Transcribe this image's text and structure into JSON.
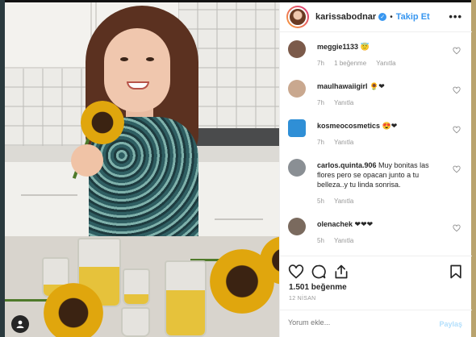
{
  "post": {
    "username": "karissabodnar",
    "follow_label": "Takip Et",
    "more_label": "•••",
    "separator": "•"
  },
  "comments": [
    {
      "username": "meggie1133",
      "text": "😇",
      "time": "7h",
      "likes": "1 beğenme",
      "reply": "Yanıtla",
      "avatar_color": "#7b5a4a"
    },
    {
      "username": "maulhawaiigirl",
      "text": "🌻❤",
      "time": "7h",
      "likes": "",
      "reply": "Yanıtla",
      "avatar_color": "#c9a88f"
    },
    {
      "username": "kosmeocosmetics",
      "text": "😍❤",
      "time": "7h",
      "likes": "",
      "reply": "Yanıtla",
      "avatar_color": "#2f8fd6"
    },
    {
      "username": "carlos.quinta.906",
      "text": "Muy bonitas las flores pero se opacan junto a tu belleza..y tu linda sonrisa.",
      "time": "5h",
      "likes": "",
      "reply": "Yanıtla",
      "avatar_color": "#8a8f94"
    },
    {
      "username": "olenachek",
      "text": "❤❤❤",
      "time": "5h",
      "likes": "",
      "reply": "Yanıtla",
      "avatar_color": "#7a6a5e"
    }
  ],
  "footer": {
    "likes": "1.501 beğenme",
    "date": "12 NİSAN",
    "comment_placeholder": "Yorum ekle...",
    "share_label": "Paylaş"
  },
  "icons": {
    "like": "heart-icon",
    "comment": "comment-icon",
    "share": "share-icon",
    "save": "bookmark-icon",
    "user": "user-tag-icon"
  },
  "colors": {
    "link_blue": "#3897f0",
    "verified_blue": "#3897f0",
    "muted": "#999999"
  }
}
